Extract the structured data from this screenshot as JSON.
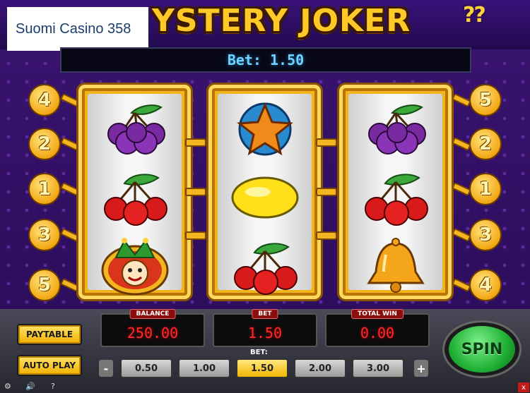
{
  "overlay": {
    "brand": "Suomi Casino 358"
  },
  "game": {
    "title": "YSTERY JOKER",
    "qmarks": "??",
    "bet_display": "Bet: 1.50"
  },
  "paylines": {
    "left": [
      "4",
      "2",
      "1",
      "3",
      "5"
    ],
    "right": [
      "5",
      "2",
      "1",
      "3",
      "4"
    ]
  },
  "reels": [
    [
      "plum",
      "cherry",
      "joker"
    ],
    [
      "star",
      "lemon",
      "cherry"
    ],
    [
      "plum",
      "cherry",
      "bell"
    ]
  ],
  "meters": {
    "balance_label": "BALANCE",
    "balance_value": "250.00",
    "bet_label": "BET",
    "bet_value": "1.50",
    "total_win_label": "TOTAL WIN",
    "total_win_value": "0.00"
  },
  "buttons": {
    "paytable": "PAYTABLE",
    "autoplay": "AUTO PLAY",
    "spin": "SPIN",
    "minus": "-",
    "plus": "+"
  },
  "bet_selector": {
    "label": "BET:",
    "options": [
      "0.50",
      "1.00",
      "1.50",
      "2.00",
      "3.00"
    ],
    "selected": "1.50"
  },
  "footer": {
    "settings_icon": "gear-icon",
    "sound_icon": "speaker-icon",
    "help": "?",
    "close": "x"
  },
  "colors": {
    "accent_gold": "#f3b520",
    "meter_red": "#ff2a2a",
    "spin_green": "#1fae33"
  }
}
